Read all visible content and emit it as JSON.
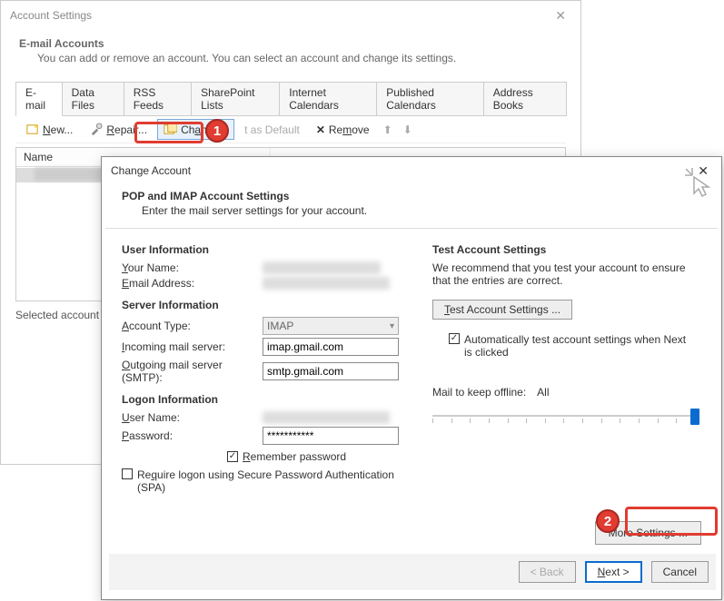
{
  "back_window": {
    "title": "Account Settings",
    "heading": "E-mail Accounts",
    "subheading": "You can add or remove an account. You can select an account and change its settings.",
    "tabs": [
      "E-mail",
      "Data Files",
      "RSS Feeds",
      "SharePoint Lists",
      "Internet Calendars",
      "Published Calendars",
      "Address Books"
    ],
    "toolbar": {
      "new": "New...",
      "repair": "Repair...",
      "change": "Change...",
      "set_default": "t as Default",
      "remove": "Remove"
    },
    "list_headers": [
      "Name",
      ""
    ],
    "footer": "Selected account de"
  },
  "markers": {
    "one": "1",
    "two": "2"
  },
  "front_window": {
    "title": "Change Account",
    "header_title": "POP and IMAP Account Settings",
    "header_sub": "Enter the mail server settings for your account.",
    "sections": {
      "user_info": "User Information",
      "server_info": "Server Information",
      "logon_info": "Logon Information"
    },
    "labels": {
      "your_name": "Your Name:",
      "email": "Email Address:",
      "account_type": "Account Type:",
      "incoming": "Incoming mail server:",
      "outgoing": "Outgoing mail server (SMTP):",
      "user_name": "User Name:",
      "password": "Password:",
      "remember_pw": "Remember password",
      "require_spa": "Require logon using Secure Password Authentication (SPA)"
    },
    "values": {
      "account_type": "IMAP",
      "incoming": "imap.gmail.com",
      "outgoing": "smtp.gmail.com",
      "password": "***********"
    },
    "right": {
      "test_heading": "Test Account Settings",
      "test_text": "We recommend that you test your account to ensure that the entries are correct.",
      "test_button": "Test Account Settings ...",
      "auto_test": "Automatically test account settings when Next is clicked",
      "mail_keep_label": "Mail to keep offline:",
      "mail_keep_value": "All",
      "more_settings": "More Settings ..."
    },
    "footer": {
      "back": "< Back",
      "next": "Next >",
      "cancel": "Cancel"
    }
  }
}
